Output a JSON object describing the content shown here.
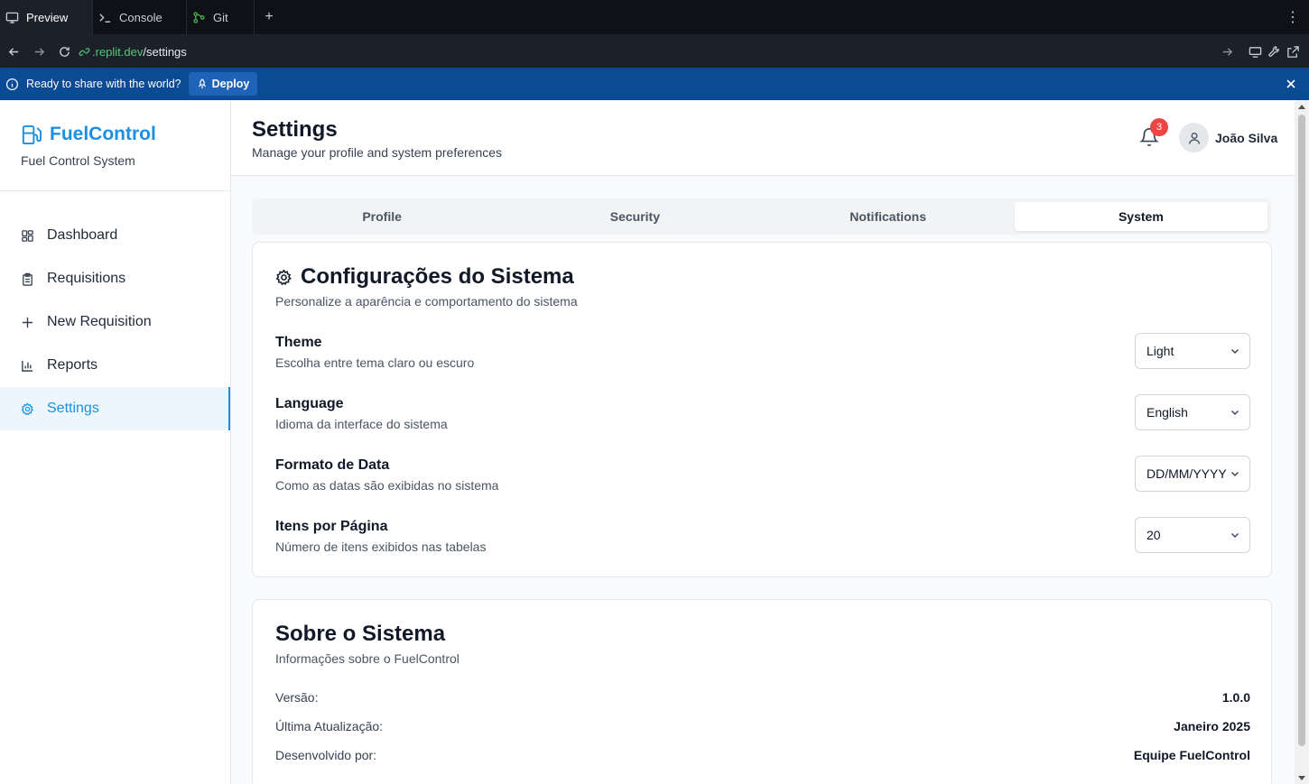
{
  "browser": {
    "tabs": [
      {
        "label": "Preview",
        "icon": "monitor-icon"
      },
      {
        "label": "Console",
        "icon": "terminal-icon"
      },
      {
        "label": "Git",
        "icon": "git-branch-icon"
      }
    ],
    "url_domain": ".replit.dev",
    "url_path": "/settings"
  },
  "banner": {
    "message": "Ready to share with the world?",
    "deploy_label": "Deploy"
  },
  "sidebar": {
    "brand": "FuelControl",
    "brand_sub": "Fuel Control System",
    "items": [
      {
        "label": "Dashboard",
        "icon": "dashboard-icon"
      },
      {
        "label": "Requisitions",
        "icon": "clipboard-icon"
      },
      {
        "label": "New Requisition",
        "icon": "plus-icon"
      },
      {
        "label": "Reports",
        "icon": "bar-chart-icon"
      },
      {
        "label": "Settings",
        "icon": "gear-icon",
        "active": true
      }
    ]
  },
  "header": {
    "title": "Settings",
    "subtitle": "Manage your profile and system preferences",
    "notification_count": "3",
    "user_name": "João Silva"
  },
  "tabs": [
    {
      "label": "Profile"
    },
    {
      "label": "Security"
    },
    {
      "label": "Notifications"
    },
    {
      "label": "System",
      "active": true
    }
  ],
  "system_card": {
    "title": "Configurações do Sistema",
    "subtitle": "Personalize a aparência e comportamento do sistema",
    "settings": [
      {
        "label": "Theme",
        "description": "Escolha entre tema claro ou escuro",
        "value": "Light"
      },
      {
        "label": "Language",
        "description": "Idioma da interface do sistema",
        "value": "English"
      },
      {
        "label": "Formato de Data",
        "description": "Como as datas são exibidas no sistema",
        "value": "DD/MM/YYYY"
      },
      {
        "label": "Itens por Página",
        "description": "Número de itens exibidos nas tabelas",
        "value": "20"
      }
    ]
  },
  "about_card": {
    "title": "Sobre o Sistema",
    "subtitle": "Informações sobre o FuelControl",
    "rows": [
      {
        "label": "Versão:",
        "value": "1.0.0"
      },
      {
        "label": "Última Atualização:",
        "value": "Janeiro 2025"
      },
      {
        "label": "Desenvolvido por:",
        "value": "Equipe FuelControl"
      }
    ]
  },
  "colors": {
    "brand": "#1d8fe0",
    "banner": "#0b4a94",
    "badge": "#ef4444"
  }
}
